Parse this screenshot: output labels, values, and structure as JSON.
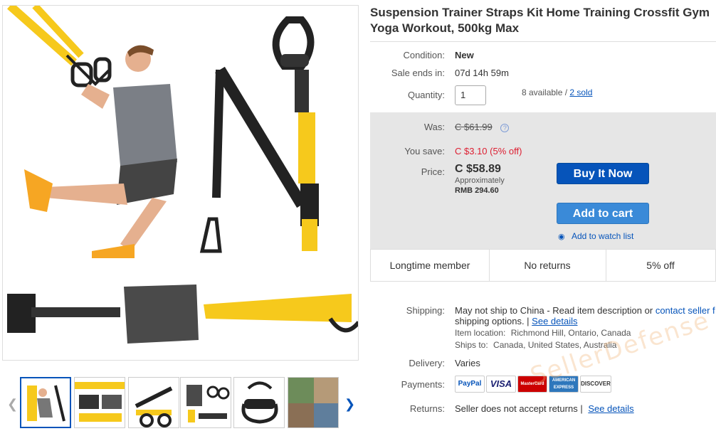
{
  "title": "Suspension Trainer Straps Kit Home Training Crossfit Gym Yoga Workout, 500kg Max",
  "condition": {
    "label": "Condition:",
    "value": "New"
  },
  "sale_ends": {
    "label": "Sale ends in:",
    "value": "07d 14h 59m"
  },
  "quantity": {
    "label": "Quantity:",
    "value": "1",
    "available": "8 available / ",
    "sold": "2 sold"
  },
  "pricing": {
    "was_label": "Was:",
    "was_value": "C $61.99",
    "info_icon": "?",
    "save_label": "You save:",
    "save_value": "C $3.10 (5% off)",
    "price_label": "Price:",
    "price_value": "C $58.89",
    "approx_label": "Approximately",
    "approx_value": "RMB 294.60"
  },
  "buttons": {
    "buy_now": "Buy It Now",
    "add_to_cart": "Add to cart",
    "watch": "Add to watch list"
  },
  "badges": [
    "Longtime member",
    "No returns",
    "5% off"
  ],
  "shipping": {
    "label": "Shipping:",
    "line1": "May not ship to China - Read item description or ",
    "contact": "contact seller f",
    "line2": "shipping options. | ",
    "see_details": "See details",
    "location_label": "Item location:",
    "location": "Richmond Hill, Ontario, Canada",
    "ships_label": "Ships to:",
    "ships": "Canada, United States, Australia"
  },
  "delivery": {
    "label": "Delivery:",
    "value": "Varies"
  },
  "payments": {
    "label": "Payments:",
    "methods": [
      "PayPal",
      "VISA",
      "MasterCard",
      "AMERICAN EXPRESS",
      "DISCOVER"
    ]
  },
  "returns": {
    "label": "Returns:",
    "value": "Seller does not accept returns | ",
    "see_details": "See details"
  },
  "watermark": "SellerDefense",
  "colors": {
    "accent": "#0654ba",
    "strap_yellow": "#f6c91c",
    "save_red": "#dd1e31"
  }
}
